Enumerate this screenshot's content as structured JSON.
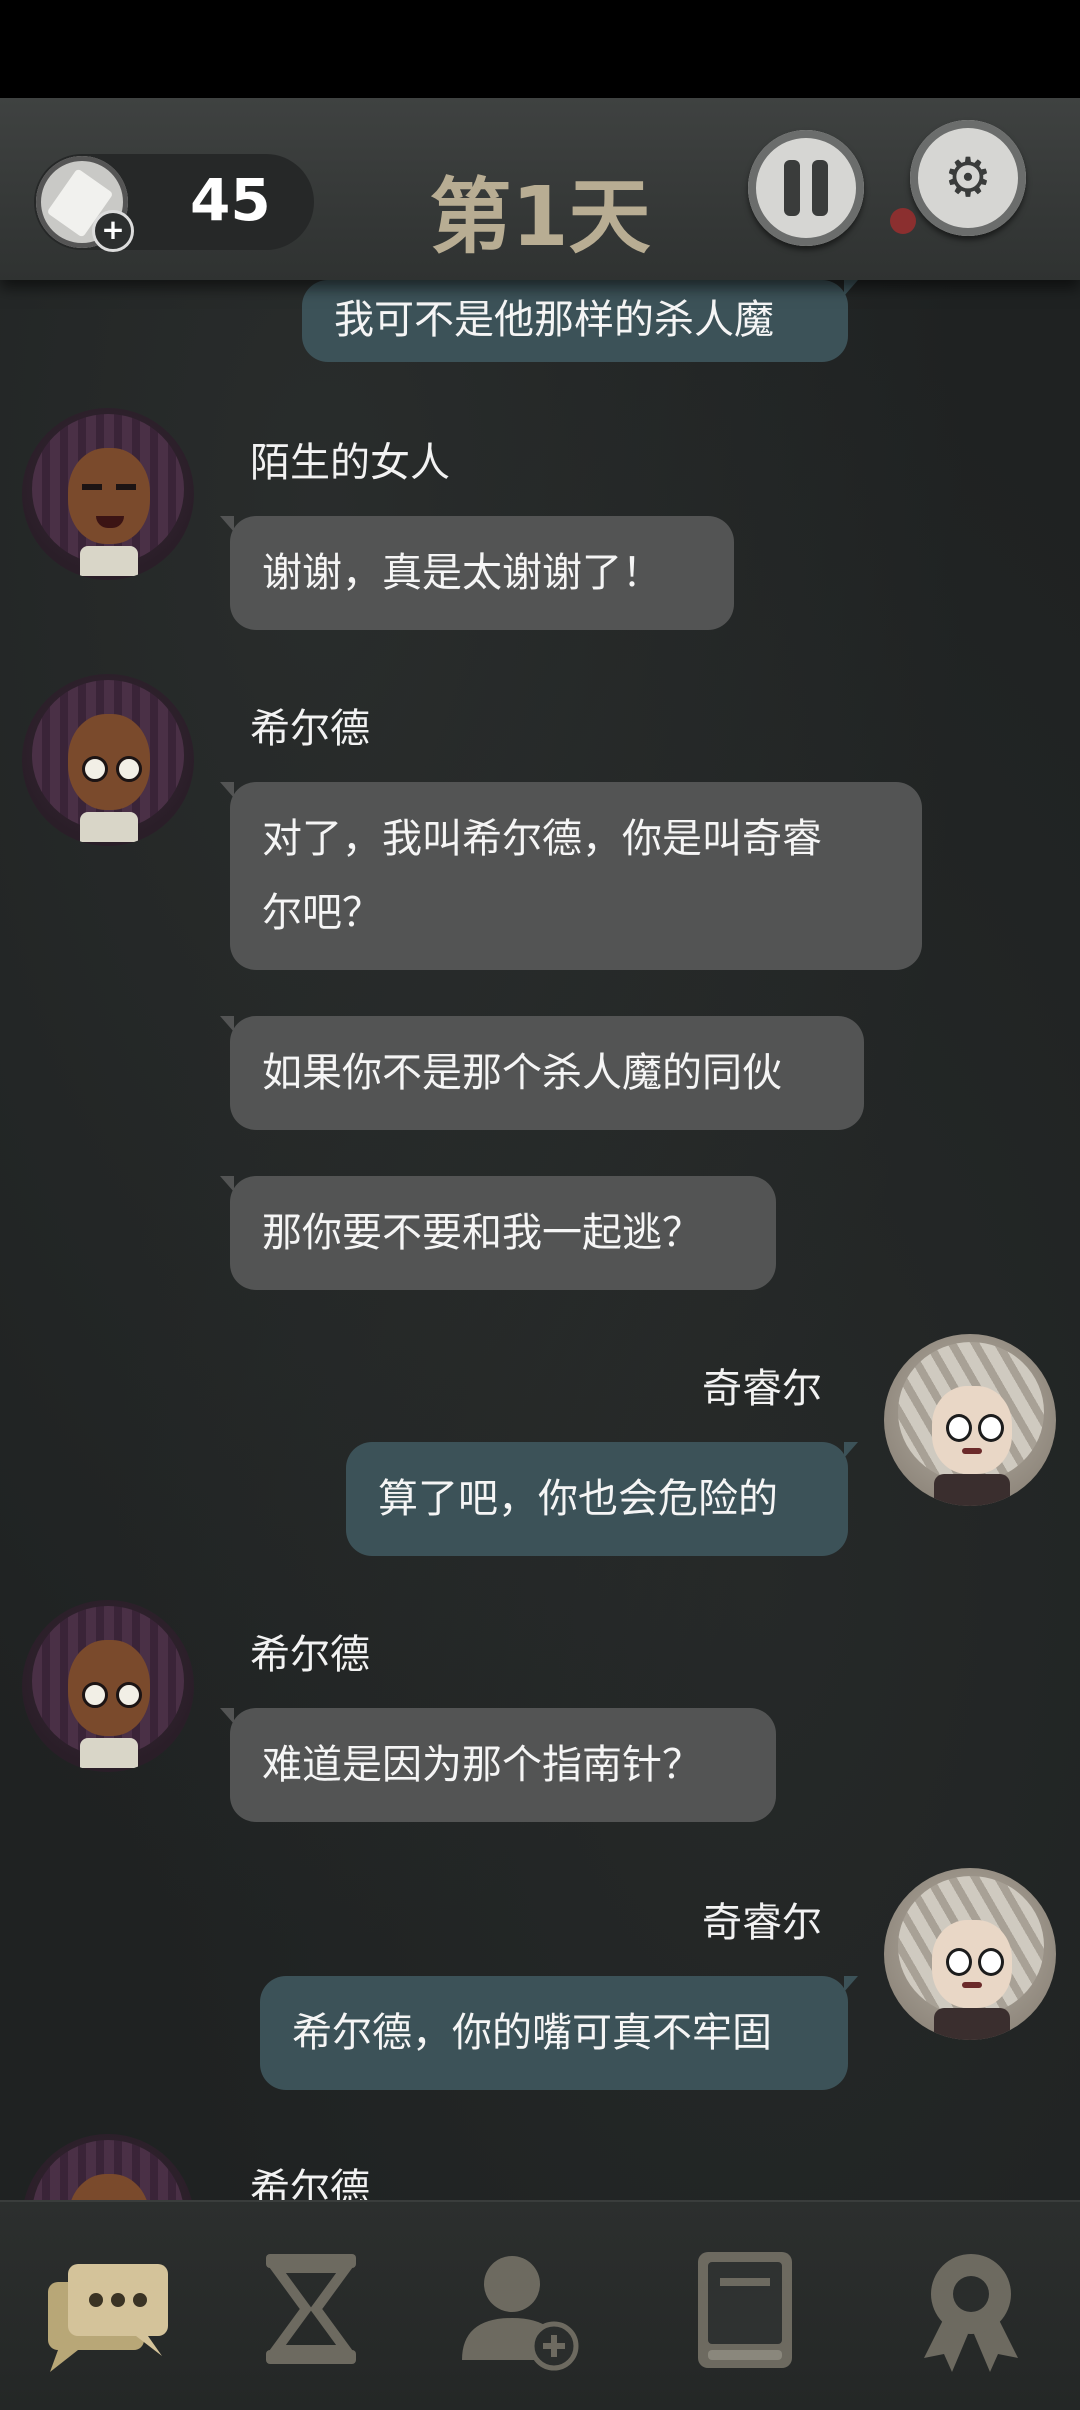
{
  "header": {
    "ticket_count": "45",
    "day_title": "第1天",
    "icons": {
      "ticket": "ticket-add-icon",
      "pause": "pause-icon",
      "settings": "gear-icon"
    }
  },
  "messages": [
    {
      "type": "outgoing",
      "text": "我可不是他那样的杀人魔"
    },
    {
      "type": "incoming",
      "name": "陌生的女人",
      "texts": [
        "谢谢，真是太谢谢了！"
      ]
    },
    {
      "type": "incoming",
      "name": "希尔德",
      "texts": [
        "对了，我叫希尔德，你是叫奇睿尔吧？",
        "如果你不是那个杀人魔的同伙",
        "那你要不要和我一起逃？"
      ]
    },
    {
      "type": "outgoing",
      "name": "奇睿尔",
      "texts": [
        "算了吧，你也会危险的"
      ]
    },
    {
      "type": "incoming",
      "name": "希尔德",
      "texts": [
        "难道是因为那个指南针？"
      ]
    },
    {
      "type": "outgoing",
      "name": "奇睿尔",
      "texts": [
        "希尔德，你的嘴可真不牢固"
      ]
    },
    {
      "type": "incoming",
      "name": "希尔德",
      "texts": []
    }
  ],
  "bubble_lines": {
    "m2_line1": "对了，我叫希尔德，你是叫奇睿",
    "m2_line2": "尔吧？"
  },
  "bottom_nav": {
    "items": [
      "chat-icon",
      "hourglass-icon",
      "add-contact-icon",
      "book-icon",
      "badge-icon"
    ],
    "active": "chat-icon",
    "active_color": "#d4c39a",
    "inactive_color": "#6d6a60"
  }
}
